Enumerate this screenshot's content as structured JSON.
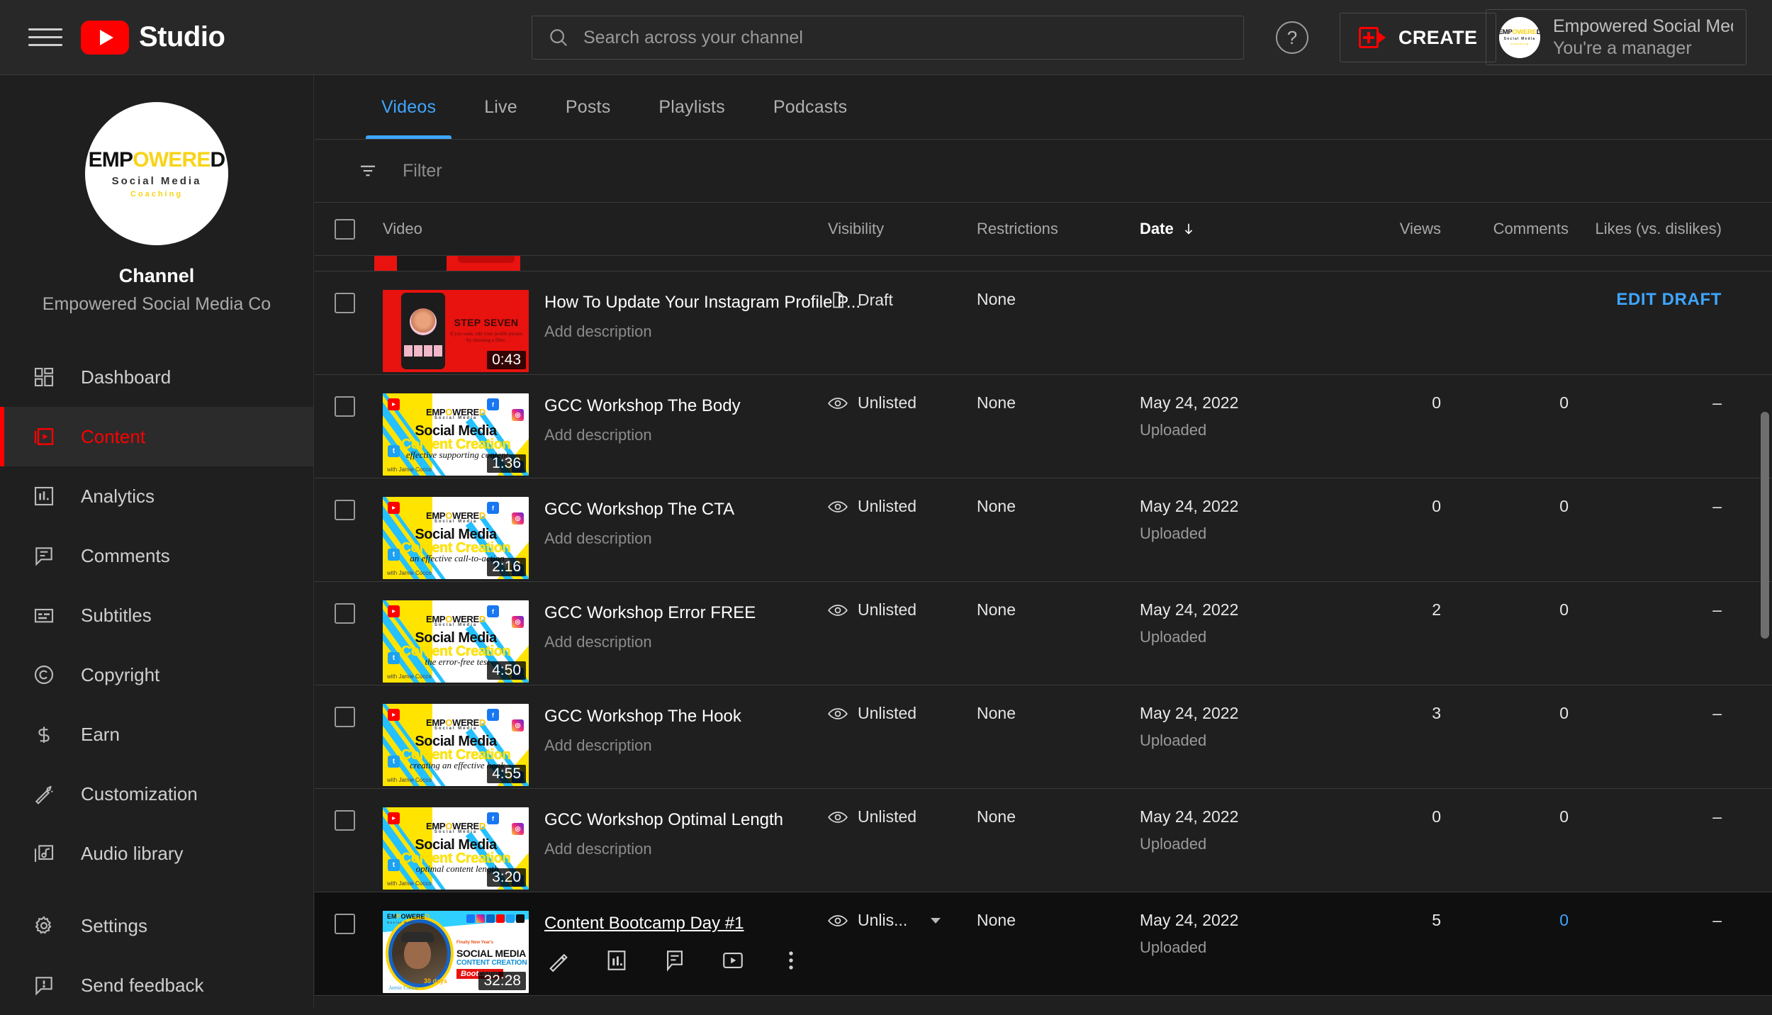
{
  "app": {
    "brand": "Studio",
    "menu_icon": "hamburger-icon"
  },
  "search": {
    "placeholder": "Search across your channel",
    "value": ""
  },
  "header": {
    "help_label": "?",
    "create_label": "CREATE",
    "account_name": "Empowered Social Medi...",
    "account_role": "You're a manager",
    "avatar_line1_a": "EMP",
    "avatar_line1_b": "OWERE",
    "avatar_line1_c": "D",
    "avatar_line2": "Social Media",
    "avatar_line3": "Coaching"
  },
  "sidebar": {
    "channel_label": "Channel",
    "channel_name": "Empowered Social Media Co",
    "items": [
      {
        "label": "Dashboard",
        "icon": "dashboard-icon",
        "active": false
      },
      {
        "label": "Content",
        "icon": "content-icon",
        "active": true
      },
      {
        "label": "Analytics",
        "icon": "analytics-icon",
        "active": false
      },
      {
        "label": "Comments",
        "icon": "comments-icon",
        "active": false
      },
      {
        "label": "Subtitles",
        "icon": "subtitles-icon",
        "active": false
      },
      {
        "label": "Copyright",
        "icon": "copyright-icon",
        "active": false
      },
      {
        "label": "Earn",
        "icon": "earn-icon",
        "active": false
      },
      {
        "label": "Customization",
        "icon": "customization-icon",
        "active": false
      },
      {
        "label": "Audio library",
        "icon": "audio-library-icon",
        "active": false
      }
    ],
    "footer_items": [
      {
        "label": "Settings",
        "icon": "gear-icon"
      },
      {
        "label": "Send feedback",
        "icon": "feedback-icon"
      }
    ]
  },
  "tabs": [
    {
      "label": "Videos",
      "active": true
    },
    {
      "label": "Live",
      "active": false
    },
    {
      "label": "Posts",
      "active": false
    },
    {
      "label": "Playlists",
      "active": false
    },
    {
      "label": "Podcasts",
      "active": false
    }
  ],
  "filter": {
    "icon": "filter-icon",
    "placeholder": "Filter"
  },
  "table": {
    "columns": {
      "video": "Video",
      "visibility": "Visibility",
      "restrictions": "Restrictions",
      "date": "Date",
      "views": "Views",
      "comments": "Comments",
      "likes": "Likes (vs. dislikes)"
    },
    "sort_column": "Date",
    "sort_direction": "descending",
    "rows": [
      {
        "title": "How To Update Your Instagram Profile P...",
        "description": "Add description",
        "duration": "0:43",
        "visibility": "Draft",
        "visibility_icon": "draft-icon",
        "restrictions": "None",
        "date": "",
        "date_status": "",
        "views": "",
        "comments": "",
        "likes": "",
        "action_label": "EDIT DRAFT",
        "thumb_style": "draft",
        "thumb_title": "STEP SEVEN",
        "thumb_sub": "If you want, edit your profile picture by choosing a filter."
      },
      {
        "title": "GCC Workshop The Body",
        "description": "Add description",
        "duration": "1:36",
        "visibility": "Unlisted",
        "visibility_icon": "eye-icon",
        "restrictions": "None",
        "date": "May 24, 2022",
        "date_status": "Uploaded",
        "views": "0",
        "comments": "0",
        "likes": "–",
        "thumb_style": "gcc",
        "thumb_tagline": "effective supporting content"
      },
      {
        "title": "GCC Workshop The CTA",
        "description": "Add description",
        "duration": "2:16",
        "visibility": "Unlisted",
        "visibility_icon": "eye-icon",
        "restrictions": "None",
        "date": "May 24, 2022",
        "date_status": "Uploaded",
        "views": "0",
        "comments": "0",
        "likes": "–",
        "thumb_style": "gcc",
        "thumb_tagline": "an effective call-to-action"
      },
      {
        "title": "GCC Workshop Error FREE",
        "description": "Add description",
        "duration": "4:50",
        "visibility": "Unlisted",
        "visibility_icon": "eye-icon",
        "restrictions": "None",
        "date": "May 24, 2022",
        "date_status": "Uploaded",
        "views": "2",
        "comments": "0",
        "likes": "–",
        "thumb_style": "gcc",
        "thumb_tagline": "the error-free test"
      },
      {
        "title": "GCC Workshop The Hook",
        "description": "Add description",
        "duration": "4:55",
        "visibility": "Unlisted",
        "visibility_icon": "eye-icon",
        "restrictions": "None",
        "date": "May 24, 2022",
        "date_status": "Uploaded",
        "views": "3",
        "comments": "0",
        "likes": "–",
        "thumb_style": "gcc",
        "thumb_tagline": "creating an effective hook"
      },
      {
        "title": "GCC Workshop Optimal Length",
        "description": "Add description",
        "duration": "3:20",
        "visibility": "Unlisted",
        "visibility_icon": "eye-icon",
        "restrictions": "None",
        "date": "May 24, 2022",
        "date_status": "Uploaded",
        "views": "0",
        "comments": "0",
        "likes": "–",
        "thumb_style": "gcc",
        "thumb_tagline": "optimal content length"
      },
      {
        "title": "Content Bootcamp Day #1",
        "description": "",
        "duration": "32:28",
        "visibility": "Unlis...",
        "visibility_icon": "eye-icon",
        "restrictions": "None",
        "date": "May 24, 2022",
        "date_status": "Uploaded",
        "views": "5",
        "comments": "0",
        "likes": "–",
        "hovered": true,
        "thumb_style": "bootcamp",
        "thumb_l1": "SOCIAL MEDIA",
        "thumb_l2": "CONTENT CREATION",
        "thumb_l3": "Bootcamp",
        "thumb_finally": "Finally New Year's",
        "thumb_days": "30 days",
        "actions": [
          {
            "name": "edit-icon",
            "label": "Details"
          },
          {
            "name": "analytics-bar-icon",
            "label": "Analytics"
          },
          {
            "name": "comment-icon",
            "label": "Comments"
          },
          {
            "name": "youtube-play-icon",
            "label": "Watch on YouTube"
          },
          {
            "name": "more-options-icon",
            "label": "Options"
          }
        ]
      }
    ]
  },
  "colors": {
    "accent_blue": "#3ea6ff",
    "brand_red": "#ff0000",
    "background": "#1f1f1f",
    "topbar": "#282828",
    "brand_yellow": "#ffe400"
  }
}
